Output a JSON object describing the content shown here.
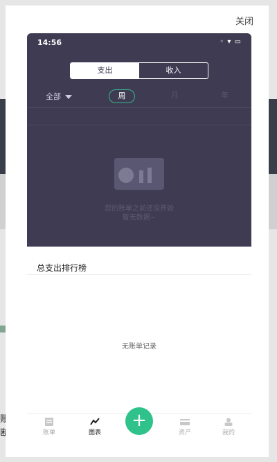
{
  "modal": {
    "close_label": "关闭"
  },
  "background": {
    "left_text": "账\n断"
  },
  "statusbar": {
    "time": "14:56",
    "right": "◦ ▾ ▭"
  },
  "segment": {
    "items": [
      "支出",
      "收入"
    ],
    "selected": "支出"
  },
  "filter": {
    "all_label": "全部",
    "periods": [
      "周",
      "月",
      "年"
    ],
    "selected_period": "周"
  },
  "empty_state": {
    "line1": "您的账单之前还没开始",
    "line2": "暂无数据~"
  },
  "ranking": {
    "title": "总支出排行榜",
    "empty_text": "无账单记录"
  },
  "tabbar": {
    "items": [
      {
        "label": "账单",
        "icon": "bill-icon"
      },
      {
        "label": "图表",
        "icon": "chart-icon"
      },
      {
        "label": "+",
        "icon": "add-icon"
      },
      {
        "label": "资产",
        "icon": "assets-icon"
      },
      {
        "label": "我的",
        "icon": "user-icon"
      }
    ],
    "active": "图表"
  },
  "colors": {
    "dark_header": "#3e3b52",
    "accent_green": "#2fc28b"
  }
}
